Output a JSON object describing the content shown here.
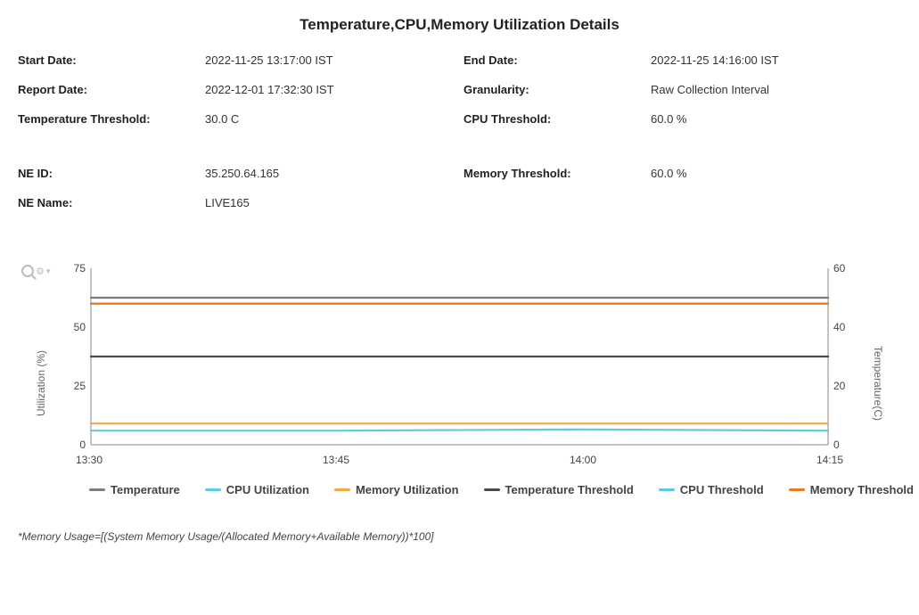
{
  "title": "Temperature,CPU,Memory Utilization Details",
  "meta": {
    "start_date_label": "Start Date:",
    "start_date": "2022-11-25 13:17:00 IST",
    "end_date_label": "End Date:",
    "end_date": "2022-11-25 14:16:00 IST",
    "report_date_label": "Report Date:",
    "report_date": "2022-12-01 17:32:30 IST",
    "granularity_label": "Granularity:",
    "granularity": "Raw Collection Interval",
    "temp_threshold_label": "Temperature Threshold:",
    "temp_threshold": "30.0 C",
    "cpu_threshold_label": "CPU Threshold:",
    "cpu_threshold": "60.0 %",
    "ne_id_label": "NE ID:",
    "ne_id": "35.250.64.165",
    "mem_threshold_label": "Memory Threshold:",
    "mem_threshold": "60.0 %",
    "ne_name_label": "NE Name:",
    "ne_name": "LIVE165"
  },
  "axes": {
    "left_label": "Utilization (%)",
    "right_label": "Temperature(C)",
    "left_ticks": [
      "0",
      "25",
      "50",
      "75"
    ],
    "right_ticks": [
      "0",
      "20",
      "40",
      "60"
    ],
    "x_ticks": [
      "13:30",
      "13:45",
      "14:00",
      "14:15"
    ]
  },
  "legend": {
    "temperature": "Temperature",
    "cpu_util": "CPU Utilization",
    "mem_util": "Memory Utilization",
    "temp_thr": "Temperature Threshold",
    "cpu_thr": "CPU Threshold",
    "mem_thr": "Memory Threshold"
  },
  "colors": {
    "temperature": "#7d7d7d",
    "cpu_util": "#63c7e6",
    "mem_util": "#f4a84a",
    "temp_thr": "#4a4a4a",
    "cpu_thr": "#63c7e6",
    "mem_thr": "#e77a1f"
  },
  "footnote": "*Memory Usage=[(System Memory Usage/(Allocated Memory+Available Memory))*100]",
  "chart_data": {
    "type": "line",
    "x_ticks": [
      "13:30",
      "13:45",
      "14:00",
      "14:15"
    ],
    "left_axis": {
      "label": "Utilization (%)",
      "lim": [
        0,
        75
      ]
    },
    "right_axis": {
      "label": "Temperature(C)",
      "lim": [
        0,
        60
      ]
    },
    "series": [
      {
        "name": "Temperature",
        "axis": "right",
        "color": "#7d7d7d",
        "values": [
          50,
          50,
          50,
          50
        ]
      },
      {
        "name": "CPU Utilization",
        "axis": "left",
        "color": "#63c7e6",
        "values": [
          6,
          6,
          6.5,
          6
        ]
      },
      {
        "name": "Memory Utilization",
        "axis": "left",
        "color": "#f4a84a",
        "values": [
          9,
          9,
          9,
          9
        ]
      },
      {
        "name": "Temperature Threshold",
        "axis": "right",
        "color": "#4a4a4a",
        "values": [
          30,
          30,
          30,
          30
        ]
      },
      {
        "name": "CPU Threshold",
        "axis": "left",
        "color": "#63c7e6",
        "values": [
          60,
          60,
          60,
          60
        ]
      },
      {
        "name": "Memory Threshold",
        "axis": "left",
        "color": "#e77a1f",
        "values": [
          60,
          60,
          60,
          60
        ]
      }
    ]
  }
}
